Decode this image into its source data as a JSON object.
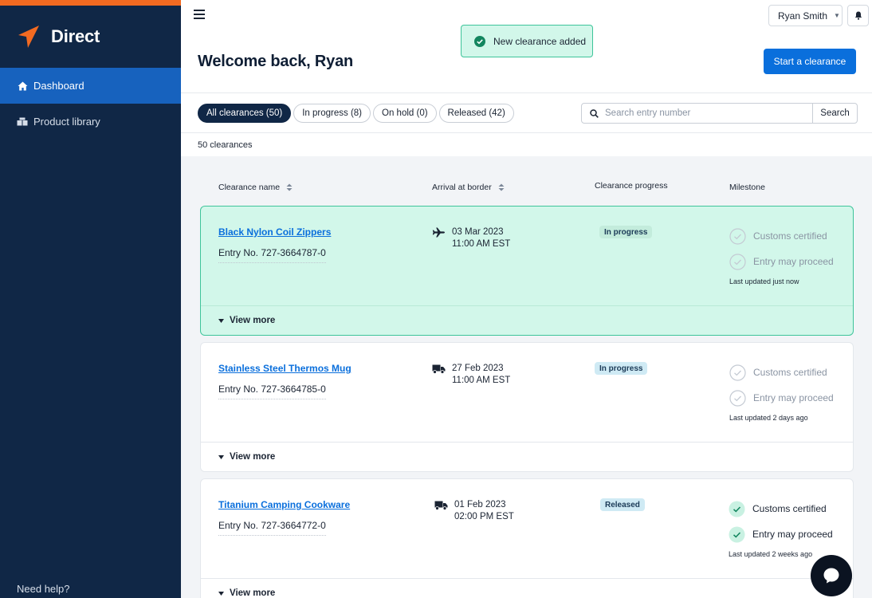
{
  "sidebar": {
    "brand": "Direct",
    "items": [
      {
        "label": "Dashboard",
        "active": true,
        "icon": "home-icon"
      },
      {
        "label": "Product library",
        "active": false,
        "icon": "boxes-icon"
      }
    ],
    "help": "Need help?"
  },
  "header": {
    "user": "Ryan Smith",
    "title": "Welcome back, Ryan",
    "primary_action": "Start a clearance"
  },
  "toast": {
    "message": "New clearance added",
    "icon": "check-circle-icon"
  },
  "filters": {
    "tabs": [
      {
        "label": "All clearances (50)",
        "active": true
      },
      {
        "label": "In progress (8)",
        "active": false
      },
      {
        "label": "On hold (0)",
        "active": false
      },
      {
        "label": "Released (42)",
        "active": false
      }
    ]
  },
  "search": {
    "placeholder": "Search entry number",
    "value": "",
    "button": "Search"
  },
  "results": {
    "count_label": "50 clearances"
  },
  "columns": {
    "name": "Clearance name",
    "arrival": "Arrival at border",
    "progress": "Clearance progress",
    "milestone": "Milestone"
  },
  "clearances": [
    {
      "name": "Black Nylon Coil Zippers",
      "entry": "Entry No. 727-3664787-0",
      "mode": "plane-icon",
      "date": "03 Mar 2023",
      "time": "11:00 AM EST",
      "status": "In progress",
      "milestones": [
        {
          "label": "Customs certified",
          "done": false
        },
        {
          "label": "Entry may proceed",
          "done": false
        }
      ],
      "updated": "Last updated just now",
      "view_more": "View more"
    },
    {
      "name": "Stainless Steel Thermos Mug",
      "entry": "Entry No. 727-3664785-0",
      "mode": "truck-icon",
      "date": "27 Feb 2023",
      "time": "11:00 AM EST",
      "status": "In progress",
      "milestones": [
        {
          "label": "Customs certified",
          "done": false
        },
        {
          "label": "Entry may proceed",
          "done": false
        }
      ],
      "updated": "Last updated 2 days ago",
      "view_more": "View more"
    },
    {
      "name": "Titanium Camping Cookware",
      "entry": "Entry No. 727-3664772-0",
      "mode": "truck-icon",
      "date": "01 Feb 2023",
      "time": "02:00 PM EST",
      "status": "Released",
      "milestones": [
        {
          "label": "Customs certified",
          "done": true
        },
        {
          "label": "Entry may proceed",
          "done": true
        }
      ],
      "updated": "Last updated 2 weeks ago",
      "view_more": "View more"
    }
  ],
  "colors": {
    "sidebar_bg": "#102746",
    "brand_accent": "#f26a21",
    "nav_active": "#1762be",
    "primary": "#0a6fdc",
    "success_bg": "#d2f7ea",
    "success_border": "#3ec49a"
  }
}
